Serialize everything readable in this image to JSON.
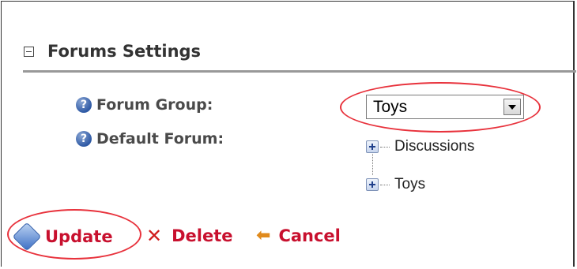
{
  "section": {
    "title": "Forums Settings"
  },
  "fields": {
    "forum_group_label": "Forum Group:",
    "default_forum_label": "Default Forum:"
  },
  "forum_group_select": {
    "selected_value": "Toys"
  },
  "forum_tree": {
    "items": [
      {
        "label": "Discussions"
      },
      {
        "label": "Toys"
      }
    ]
  },
  "actions": {
    "update_label": "Update",
    "delete_label": "Delete",
    "cancel_label": "Cancel"
  },
  "icons": {
    "help": "question-circle-icon",
    "collapse": "minus-box-icon",
    "expand": "plus-box-icon",
    "update": "update-diamond-icon",
    "delete": "x-icon",
    "cancel": "back-arrow-icon"
  },
  "colors": {
    "action_text": "#c8102e",
    "highlight": "#e8323c",
    "section_rule": "#999999"
  }
}
